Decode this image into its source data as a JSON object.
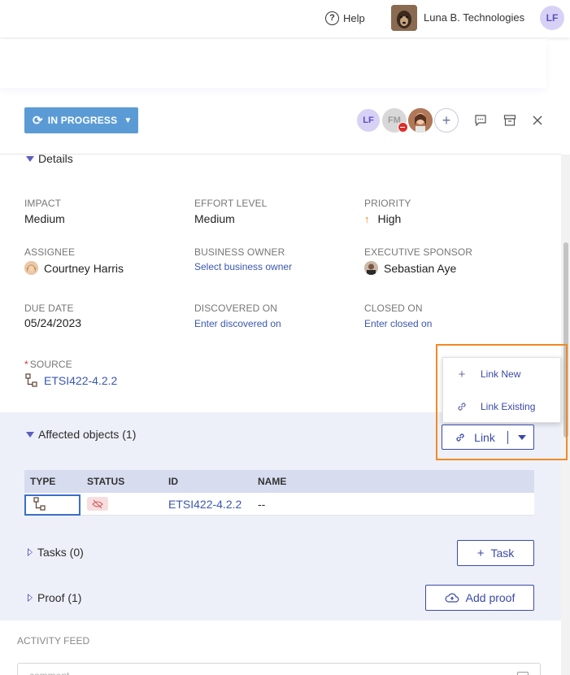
{
  "header": {
    "help_label": "Help",
    "org_name": "Luna B. Technologies",
    "user_initials": "LF"
  },
  "status_button": {
    "label": "IN PROGRESS"
  },
  "watchers": {
    "lf": "LF",
    "fm": "FM"
  },
  "details": {
    "title": "Details",
    "impact": {
      "label": "IMPACT",
      "value": "Medium"
    },
    "effort": {
      "label": "EFFORT LEVEL",
      "value": "Medium"
    },
    "priority": {
      "label": "PRIORITY",
      "value": "High"
    },
    "assignee": {
      "label": "ASSIGNEE",
      "value": "Courtney Harris"
    },
    "business_owner": {
      "label": "BUSINESS OWNER",
      "value": "Select business owner"
    },
    "executive_sponsor": {
      "label": "EXECUTIVE SPONSOR",
      "value": "Sebastian Aye"
    },
    "due_date": {
      "label": "DUE DATE",
      "value": "05/24/2023"
    },
    "discovered_on": {
      "label": "DISCOVERED ON",
      "value": "Enter discovered on"
    },
    "closed_on": {
      "label": "CLOSED ON",
      "value": "Enter closed on"
    },
    "source": {
      "required_mark": "*",
      "label": "SOURCE",
      "value": "ETSI422-4.2.2"
    }
  },
  "link_menu": {
    "new": "Link New",
    "existing": "Link Existing"
  },
  "link_button": {
    "label": "Link"
  },
  "affected": {
    "title": "Affected objects (1)",
    "columns": [
      "TYPE",
      "STATUS",
      "ID",
      "NAME"
    ],
    "rows": [
      {
        "id": "ETSI422-4.2.2",
        "name": "--"
      }
    ]
  },
  "tasks": {
    "title": "Tasks (0)",
    "button": "Task"
  },
  "proof": {
    "title": "Proof (1)",
    "button": "Add proof"
  },
  "activity": {
    "label": "ACTIVITY FEED",
    "placeholder": "comment"
  }
}
